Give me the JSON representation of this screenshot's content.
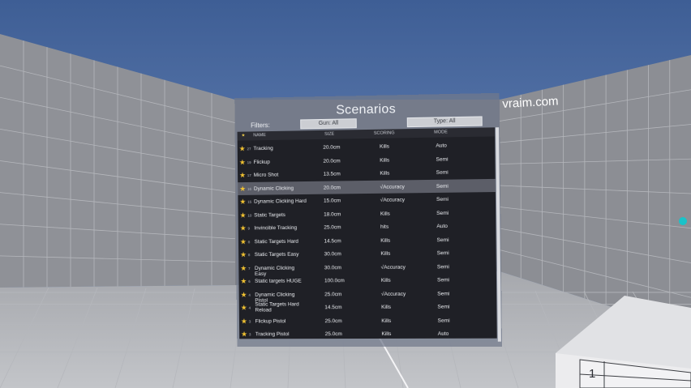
{
  "title": "Scenarios",
  "filters": {
    "label": "Filters:",
    "gun": "Gun: All",
    "type": "Type: All"
  },
  "columns": {
    "fav": "★",
    "name": "NAME",
    "size": "SIZE",
    "scoring": "SCORING",
    "mode": "MODE"
  },
  "rows": [
    {
      "n": "27",
      "name": "Tracking",
      "size": "20.0cm",
      "scoring": "Kills",
      "mode": "Auto"
    },
    {
      "n": "19",
      "name": "Flickup",
      "size": "20.0cm",
      "scoring": "Kills",
      "mode": "Semi"
    },
    {
      "n": "17",
      "name": "Micro Shot",
      "size": "13.5cm",
      "scoring": "Kills",
      "mode": "Semi"
    },
    {
      "n": "16",
      "name": "Dynamic Clicking",
      "size": "20.0cm",
      "scoring": "√Accuracy",
      "mode": "Semi"
    },
    {
      "n": "15",
      "name": "Dynamic Clicking Hard",
      "size": "15.0cm",
      "scoring": "√Accuracy",
      "mode": "Semi"
    },
    {
      "n": "10",
      "name": "Static Targets",
      "size": "18.0cm",
      "scoring": "Kills",
      "mode": "Semi"
    },
    {
      "n": "9",
      "name": "Invincible Tracking",
      "size": "25.0cm",
      "scoring": "hits",
      "mode": "Auto"
    },
    {
      "n": "8",
      "name": "Static Targets Hard",
      "size": "14.5cm",
      "scoring": "Kills",
      "mode": "Semi"
    },
    {
      "n": "8",
      "name": "Static Targets Easy",
      "size": "30.0cm",
      "scoring": "Kills",
      "mode": "Semi"
    },
    {
      "n": "7",
      "name": "Dynamic Clicking Easy",
      "size": "30.0cm",
      "scoring": "√Accuracy",
      "mode": "Semi"
    },
    {
      "n": "6",
      "name": "Static targets HUGE",
      "size": "100.0cm",
      "scoring": "Kills",
      "mode": "Semi"
    },
    {
      "n": "4",
      "name": "Dynamic Clicking Pistol",
      "size": "25.0cm",
      "scoring": "√Accuracy",
      "mode": "Semi"
    },
    {
      "n": "4",
      "name": "Static Targets Hard Reload",
      "size": "14.5cm",
      "scoring": "Kills",
      "mode": "Semi"
    },
    {
      "n": "3",
      "name": "Flickup Pistol",
      "size": "25.0cm",
      "scoring": "Kills",
      "mode": "Semi"
    },
    {
      "n": "3",
      "name": "Tracking Pistol",
      "size": "25.0cm",
      "scoring": "Kills",
      "mode": "Auto"
    }
  ],
  "highlighted_row": 3,
  "watermark": "vraim.com",
  "cube_label": "1",
  "icons": {
    "favorite": "star-icon",
    "pointer": "laser-pointer"
  },
  "colors": {
    "sky": "#5f7fb4",
    "wall": "#8e9096",
    "floor": "#b4b6ba",
    "list_bg": "#1f2026",
    "star": "#f1c232",
    "highlight": "#5c5e68"
  }
}
